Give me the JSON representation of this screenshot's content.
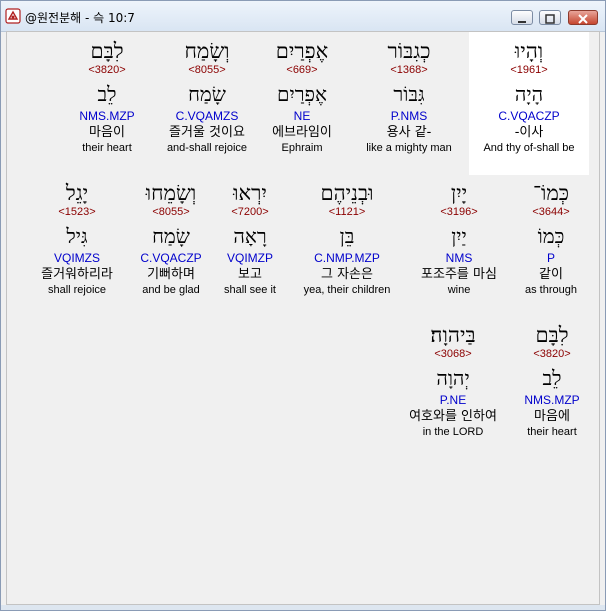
{
  "window": {
    "title": "@원전분해 - 슥 10:7",
    "icon": "app-icon"
  },
  "rows": [
    {
      "words": [
        {
          "hebrew": "וְהָיוּ",
          "strong": "<1961>",
          "lemma": "הָיָה",
          "morph": "C.VQACZP",
          "korean": "-이사",
          "english": "And thy of-shall be",
          "highlight": true
        },
        {
          "hebrew": "כְגִבּוֹר",
          "strong": "<1368>",
          "lemma": "גִּבּוֹר",
          "morph": "P.NMS",
          "korean": "용사 같-",
          "english": "like a mighty man",
          "highlight": false
        },
        {
          "hebrew": "אֶפְרַיִם",
          "strong": "<669>",
          "lemma": "אֶפְרַיִם",
          "morph": "NE",
          "korean": "에브라임이",
          "english": "Ephraim",
          "highlight": false
        },
        {
          "hebrew": "וְשָׂמַח",
          "strong": "<8055>",
          "lemma": "שָׂמַח",
          "morph": "C.VQAMZS",
          "korean": "즐거울 것이요",
          "english": "and-shall rejoice",
          "highlight": false
        },
        {
          "hebrew": "לִבָּם",
          "strong": "<3820>",
          "lemma": "לֵב",
          "morph": "NMS.MZP",
          "korean": "마음이",
          "english": "their heart",
          "highlight": false
        }
      ]
    },
    {
      "words": [
        {
          "hebrew": "כְּמוֹ־",
          "strong": "<3644>",
          "lemma": "כְּמוֹ",
          "morph": "P",
          "korean": "같이",
          "english": "as through",
          "highlight": false
        },
        {
          "hebrew": "יָיִן",
          "strong": "<3196>",
          "lemma": "יַיִן",
          "morph": "NMS",
          "korean": "포조주를 마심",
          "english": "wine",
          "highlight": false
        },
        {
          "hebrew": "וּבְנֵיהֶם",
          "strong": "<1121>",
          "lemma": "בֵּן",
          "morph": "C.NMP.MZP",
          "korean": "그 자손은",
          "english": "yea, their children",
          "highlight": false
        },
        {
          "hebrew": "יִרְאוּ",
          "strong": "<7200>",
          "lemma": "רָאָה",
          "morph": "VQIMZP",
          "korean": "보고",
          "english": "shall see it",
          "highlight": false
        },
        {
          "hebrew": "וְשָׂמֵחוּ",
          "strong": "<8055>",
          "lemma": "שָׂמַח",
          "morph": "C.VQACZP",
          "korean": "기뻐하며",
          "english": "and be glad",
          "highlight": false
        },
        {
          "hebrew": "יָגֵל",
          "strong": "<1523>",
          "lemma": "גִּיל",
          "morph": "VQIMZS",
          "korean": "즐거워하리라",
          "english": "shall rejoice",
          "highlight": false
        }
      ]
    },
    {
      "words": [
        {
          "hebrew": "לִבָּם",
          "strong": "<3820>",
          "lemma": "לֵב",
          "morph": "NMS.MZP",
          "korean": "마음에",
          "english": "their heart",
          "highlight": false
        },
        {
          "hebrew": "בַּיהוָה׃",
          "strong": "<3068>",
          "lemma": "יְהוָה",
          "morph": "P.NE",
          "korean": "여호와를 인하여",
          "english": "in the LORD",
          "highlight": false
        }
      ]
    }
  ]
}
